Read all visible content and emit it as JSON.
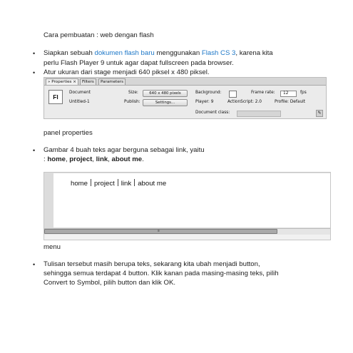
{
  "heading": "Cara pembuatan : web dengan flash",
  "bullet_glyph": "•",
  "step1": {
    "line1_a": "Siapkan sebuah ",
    "line1_link1": "dokumen flash baru",
    "line1_b": " menggunakan ",
    "line1_link2": "Flash CS 3",
    "line1_c": ", karena kita",
    "line2": "perlu Flash Player 9 untuk agar dapat fullscreen pada browser."
  },
  "step2": "Atur ukuran dari stage menjadi 640 piksel x 480 piksel.",
  "properties_panel": {
    "tabs": [
      "» Properties ×",
      "Filters",
      "Parameters"
    ],
    "icon_label": "Fl",
    "doc_type": "Document",
    "doc_name": "Untitled-1",
    "size_label": "Size:",
    "size_button": "640 x 480 pixels",
    "publish_label": "Publish:",
    "publish_button": "Settings...",
    "background_label": "Background:",
    "frame_rate_label": "Frame rate:",
    "frame_rate_value": "12",
    "fps_label": "fps",
    "player_text": "Player:  9",
    "actionscript_text": "ActionScript:  2.0",
    "profile_text": "Profile:  Default",
    "doc_class_label": "Document class:"
  },
  "caption1": "panel properties",
  "step3": {
    "line1": "Gambar 4 buah teks agar berguna sebagai link, yaitu",
    "line2_prefix": ": ",
    "items": [
      "home",
      "project",
      "link",
      "about me"
    ],
    "separator": ", ",
    "end": "."
  },
  "stage_menu": [
    "home",
    "project",
    "link",
    "about me"
  ],
  "stage_grip": "≡",
  "caption2": "menu",
  "step4": {
    "line1": "Tulisan tersebut masih berupa teks, sekarang kita ubah menjadi button,",
    "line2": "sehingga semua terdapat 4 button. Klik kanan pada masing-masing  teks, pilih",
    "line3": "Convert to Symbol, pilih button dan klik OK."
  },
  "colors": {
    "link": "#1e78c8",
    "text": "#222222"
  }
}
